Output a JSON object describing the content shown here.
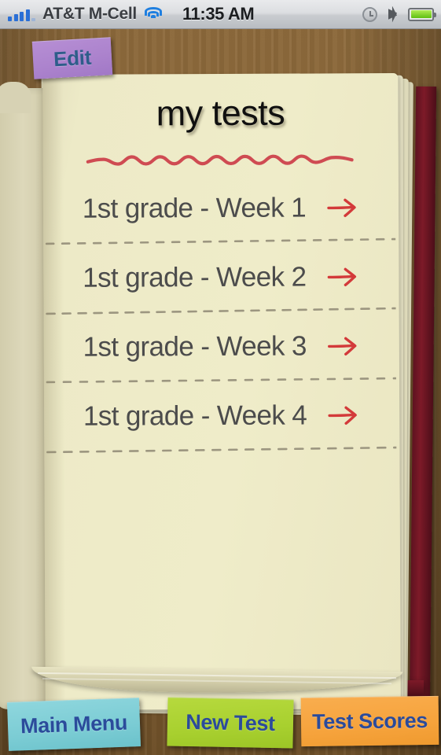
{
  "statusbar": {
    "carrier": "AT&T M-Cell",
    "time": "11:35 AM",
    "signal_icon": "signal-bars-icon",
    "wifi_icon": "wifi-icon",
    "alarm_icon": "alarm-clock-icon",
    "bluetooth_icon": "bluetooth-icon",
    "battery_icon": "battery-icon"
  },
  "toolbar": {
    "edit_label": "Edit"
  },
  "page": {
    "title": "my tests",
    "squiggle_color": "#cf4b52",
    "paper_color": "#ECE9C6",
    "text_color": "#4c4c4c"
  },
  "list": {
    "items": [
      {
        "label": "1st grade - Week 1",
        "arrow_icon": "arrow-right-icon"
      },
      {
        "label": "1st grade - Week 2",
        "arrow_icon": "arrow-right-icon"
      },
      {
        "label": "1st grade - Week 3",
        "arrow_icon": "arrow-right-icon"
      },
      {
        "label": "1st grade - Week 4",
        "arrow_icon": "arrow-right-icon"
      }
    ]
  },
  "tabbar": {
    "main_menu_label": "Main Menu",
    "new_test_label": "New Test",
    "test_scores_label": "Test Scores",
    "main_menu_color": "#7bccd4",
    "new_test_color": "#a8d02f",
    "test_scores_color": "#f6a33c",
    "label_color": "#2b4b9b"
  }
}
